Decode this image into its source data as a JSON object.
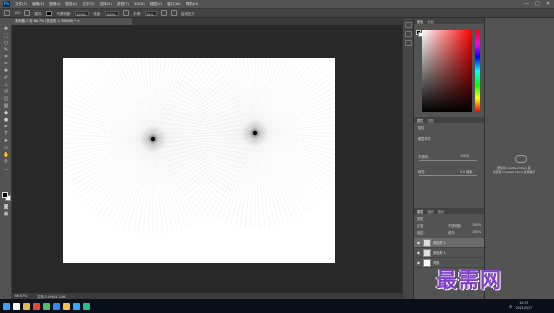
{
  "app": {
    "logo": "Ps",
    "menus": [
      "文件(F)",
      "编辑(E)",
      "图像(I)",
      "图层(L)",
      "文字(Y)",
      "选择(S)",
      "滤镜(T)",
      "3D(D)",
      "视图(V)",
      "窗口(W)",
      "帮助(H)"
    ],
    "window_controls": [
      "—",
      "□",
      "✕"
    ]
  },
  "options_bar": {
    "size_value": "100",
    "mode_label": "模式:",
    "opacity_label": "不透明度:",
    "opacity_value": "100%",
    "flow_label": "流量:",
    "flow_value": "100%",
    "smoothing_label": "平滑:",
    "smoothing_value": "10%",
    "pressure_label": "启用压力"
  },
  "document": {
    "tab_title": "未标题-1 @ 66.7% (多边形 1, RGB/8) *",
    "close_icon": "close-icon"
  },
  "status_bar": {
    "zoom": "66.67%",
    "doc_info": "文档:3.44M/4.10M"
  },
  "panels": {
    "color": {
      "tabs": [
        "颜色",
        "色板"
      ],
      "fg_color": "#000000",
      "bg_color": "#ffffff",
      "picker_hue": "#ff0000"
    },
    "properties": {
      "tabs": [
        "属性",
        "调整"
      ],
      "title": "属性",
      "section": "图层样式",
      "opacity_label": "不透明:",
      "opacity_value": "100%",
      "fill_label": "填充:",
      "fill_value": "0.0 像素"
    },
    "layers": {
      "tabs": [
        "图层",
        "通道",
        "路径"
      ],
      "kind_label": "类型",
      "blend_mode": "正常",
      "opacity_label": "不透明度:",
      "opacity_value": "100%",
      "lock_label": "锁定:",
      "fill_label": "填充:",
      "fill_value": "100%",
      "items": [
        {
          "name": "多边形 2",
          "selected": true
        },
        {
          "name": "多边形 1",
          "selected": false
        },
        {
          "name": "背景",
          "selected": false
        }
      ]
    },
    "libraries": {
      "message_line1": "要使用 Creative Cloud 库,",
      "message_line2": "请安装 Creative Cloud 应用程序"
    }
  },
  "taskbar": {
    "time": "10:37",
    "date": "2021/5/17",
    "tray_text": "中"
  },
  "watermark": "最需网"
}
